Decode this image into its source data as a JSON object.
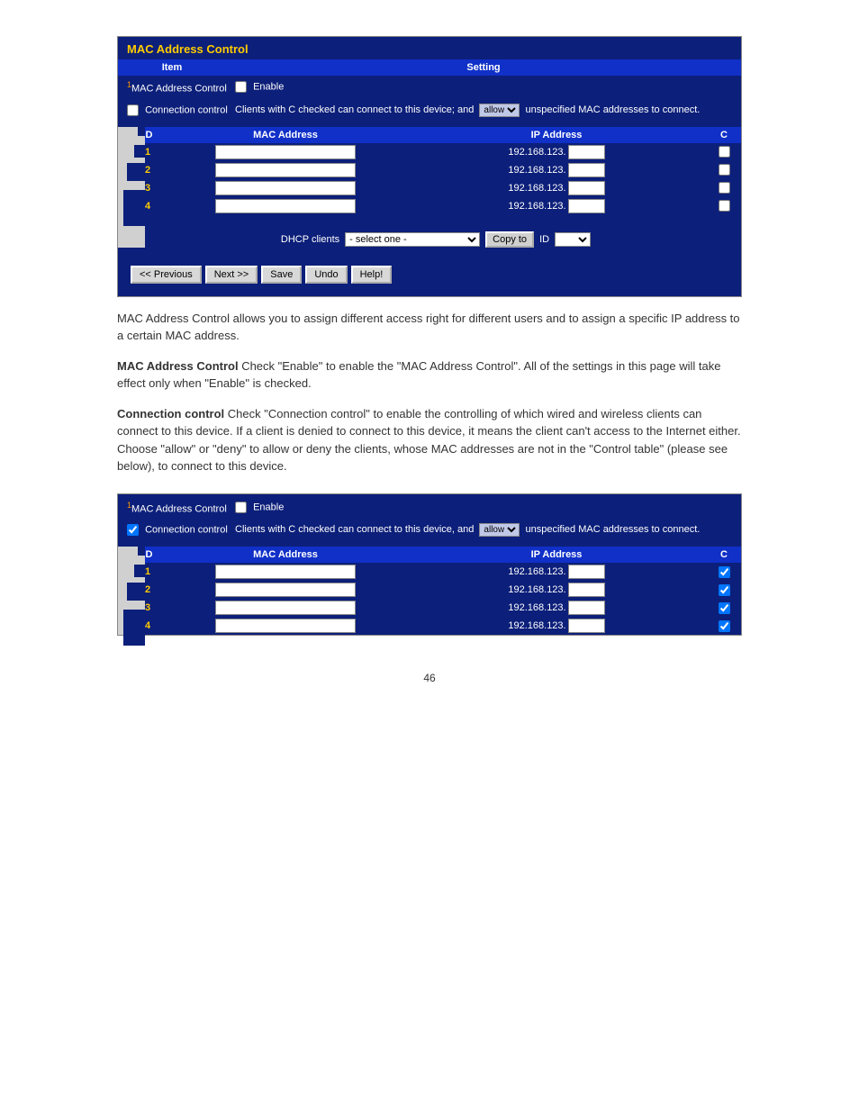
{
  "panel1": {
    "title": "MAC Address Control",
    "header_item": "Item",
    "header_setting": "Setting",
    "row_mac_ctrl_label": "MAC Address Control",
    "enable_label": "Enable",
    "row_conn_ctrl_label": "Connection control",
    "conn_text_a": "Clients with C checked can connect to this device; and ",
    "conn_sel_val": "allow",
    "conn_text_b": " unspecified MAC addresses to connect.",
    "tbl": {
      "id": "ID",
      "mac": "MAC Address",
      "ip": "IP Address",
      "c": "C",
      "rows": [
        {
          "id": "1",
          "mac": "",
          "ip_prefix": "192.168.123.",
          "ip_suffix": "",
          "c": false
        },
        {
          "id": "2",
          "mac": "",
          "ip_prefix": "192.168.123.",
          "ip_suffix": "",
          "c": false
        },
        {
          "id": "3",
          "mac": "",
          "ip_prefix": "192.168.123.",
          "ip_suffix": "",
          "c": false
        },
        {
          "id": "4",
          "mac": "",
          "ip_prefix": "192.168.123.",
          "ip_suffix": "",
          "c": false
        }
      ]
    },
    "dhcp_label": "DHCP clients",
    "dhcp_sel": "- select one -",
    "copy_to": "Copy to",
    "id_label": "ID",
    "id_sel": "",
    "buttons": {
      "prev": "<< Previous",
      "next": "Next >>",
      "save": "Save",
      "undo": "Undo",
      "help": "Help!"
    }
  },
  "txt": {
    "p1_a": "MAC Address Control allows you to assign different access right for different users and to assign a specific IP address to a certain MAC address.",
    "p2_label": "MAC Address Control",
    "p2_body": "    Check \"Enable\" to enable the \"MAC Address Control\". All of the settings in this page will take effect only when \"Enable\" is checked.",
    "p3_label": "Connection control",
    "p3_body": "     Check \"Connection control\" to enable the controlling of which wired and wireless clients can connect to this device. If a client is denied to connect to this device, it means the client can't access to the Internet either. Choose \"allow\" or \"deny\" to allow or deny the clients, whose MAC addresses are not in the \"Control table\" (please see below), to connect to this device."
  },
  "panel2": {
    "row_mac_ctrl_label": "MAC Address Control",
    "enable_label": "Enable",
    "row_conn_ctrl_label": "Connection control",
    "conn_text_a": "Clients with C checked can connect to this device, and ",
    "conn_sel_val": "allow",
    "conn_text_b": " unspecified MAC addresses to connect.",
    "tbl": {
      "id": "ID",
      "mac": "MAC Address",
      "ip": "IP Address",
      "c": "C",
      "rows": [
        {
          "id": "1",
          "mac": "",
          "ip_prefix": "192.168.123.",
          "ip_suffix": "",
          "c": true
        },
        {
          "id": "2",
          "mac": "",
          "ip_prefix": "192.168.123.",
          "ip_suffix": "",
          "c": true
        },
        {
          "id": "3",
          "mac": "",
          "ip_prefix": "192.168.123.",
          "ip_suffix": "",
          "c": true
        },
        {
          "id": "4",
          "mac": "",
          "ip_prefix": "192.168.123.",
          "ip_suffix": "",
          "c": true
        }
      ]
    }
  },
  "page_number": "46"
}
